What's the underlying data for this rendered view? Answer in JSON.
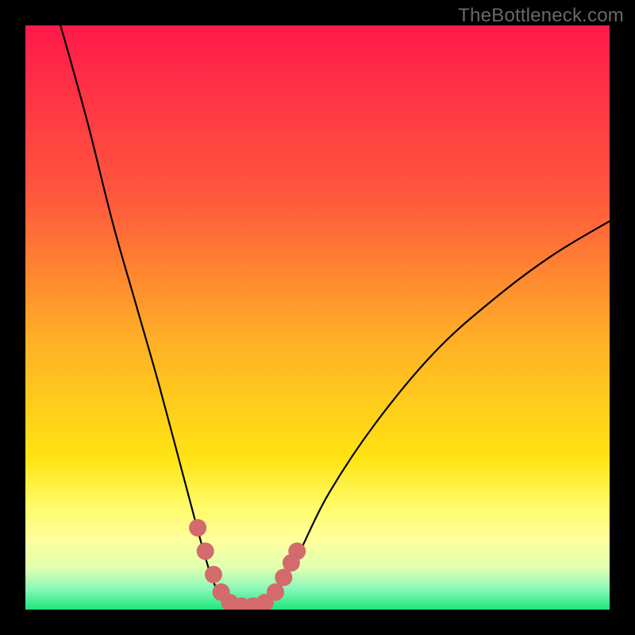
{
  "watermark": "TheBottleneck.com",
  "chart_data": {
    "type": "line",
    "title": "",
    "xlabel": "",
    "ylabel": "",
    "xlim": [
      0,
      100
    ],
    "ylim": [
      0,
      100
    ],
    "background_gradient": {
      "stops": [
        {
          "offset": 0.0,
          "color": "#ff1a4b"
        },
        {
          "offset": 0.3,
          "color": "#ff5a3c"
        },
        {
          "offset": 0.55,
          "color": "#ffb325"
        },
        {
          "offset": 0.74,
          "color": "#ffe313"
        },
        {
          "offset": 0.82,
          "color": "#fffb66"
        },
        {
          "offset": 0.88,
          "color": "#ffff9c"
        },
        {
          "offset": 0.93,
          "color": "#dfffb0"
        },
        {
          "offset": 0.965,
          "color": "#87f7b9"
        },
        {
          "offset": 1.0,
          "color": "#1de67a"
        }
      ]
    },
    "curve": {
      "name": "bottleneck-curve",
      "stroke": "#000000",
      "points": [
        {
          "x": 6.0,
          "y": 100.0
        },
        {
          "x": 8.0,
          "y": 93.0
        },
        {
          "x": 11.0,
          "y": 82.0
        },
        {
          "x": 15.0,
          "y": 66.0
        },
        {
          "x": 19.0,
          "y": 52.0
        },
        {
          "x": 23.0,
          "y": 38.0
        },
        {
          "x": 27.0,
          "y": 23.0
        },
        {
          "x": 30.5,
          "y": 10.0
        },
        {
          "x": 32.5,
          "y": 4.0
        },
        {
          "x": 34.5,
          "y": 1.2
        },
        {
          "x": 37.0,
          "y": 0.5
        },
        {
          "x": 39.5,
          "y": 0.5
        },
        {
          "x": 42.0,
          "y": 1.5
        },
        {
          "x": 44.0,
          "y": 4.5
        },
        {
          "x": 47.0,
          "y": 10.0
        },
        {
          "x": 52.0,
          "y": 20.0
        },
        {
          "x": 60.0,
          "y": 32.0
        },
        {
          "x": 70.0,
          "y": 44.0
        },
        {
          "x": 80.0,
          "y": 53.0
        },
        {
          "x": 90.0,
          "y": 60.5
        },
        {
          "x": 100.0,
          "y": 66.5
        }
      ]
    },
    "highlight": {
      "name": "highlight-segment",
      "color": "#d36a6c",
      "points": [
        {
          "x": 29.5,
          "y": 14.0
        },
        {
          "x": 30.8,
          "y": 10.0
        },
        {
          "x": 32.2,
          "y": 6.0
        },
        {
          "x": 33.5,
          "y": 3.0
        },
        {
          "x": 35.0,
          "y": 1.2
        },
        {
          "x": 37.0,
          "y": 0.6
        },
        {
          "x": 39.0,
          "y": 0.6
        },
        {
          "x": 41.0,
          "y": 1.2
        },
        {
          "x": 42.8,
          "y": 3.0
        },
        {
          "x": 44.2,
          "y": 5.5
        },
        {
          "x": 45.5,
          "y": 8.0
        },
        {
          "x": 46.5,
          "y": 10.0
        }
      ]
    }
  }
}
